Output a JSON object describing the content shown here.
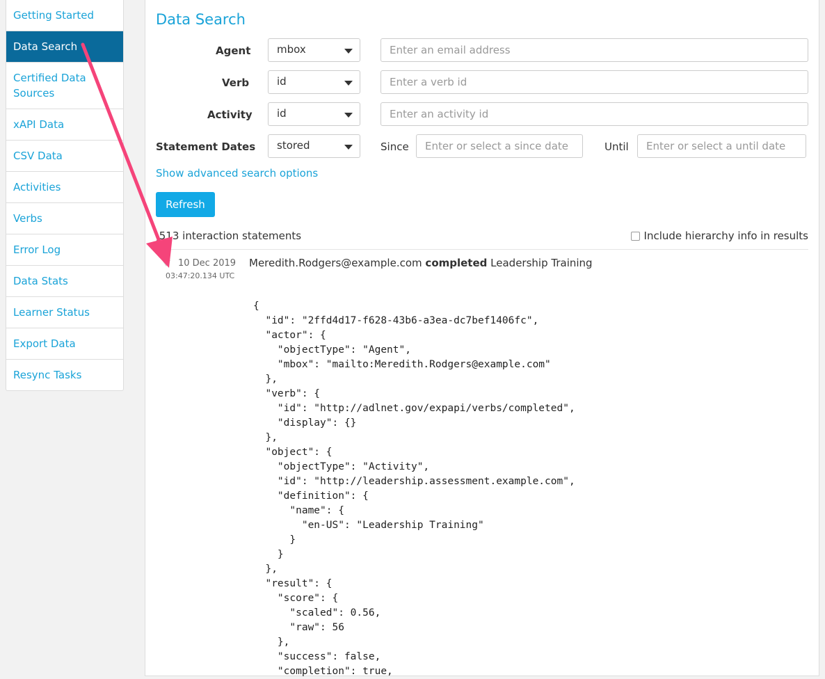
{
  "sidebar": {
    "items": [
      {
        "label": "Getting Started"
      },
      {
        "label": "Data Search"
      },
      {
        "label": "Certified Data Sources"
      },
      {
        "label": "xAPI Data"
      },
      {
        "label": "CSV Data"
      },
      {
        "label": "Activities"
      },
      {
        "label": "Verbs"
      },
      {
        "label": "Error Log"
      },
      {
        "label": "Data Stats"
      },
      {
        "label": "Learner Status"
      },
      {
        "label": "Export Data"
      },
      {
        "label": "Resync Tasks"
      }
    ],
    "active": "Data Search"
  },
  "main": {
    "title": "Data Search",
    "agent": {
      "label": "Agent",
      "select": "mbox",
      "placeholder": "Enter an email address"
    },
    "verb": {
      "label": "Verb",
      "select": "id",
      "placeholder": "Enter a verb id"
    },
    "activity": {
      "label": "Activity",
      "select": "id",
      "placeholder": "Enter an activity id"
    },
    "dates": {
      "label": "Statement Dates",
      "select": "stored",
      "since_label": "Since",
      "since_placeholder": "Enter or select a since date",
      "until_label": "Until",
      "until_placeholder": "Enter or select a until date"
    },
    "advanced_link": "Show advanced search options",
    "refresh_label": "Refresh",
    "count_text": ",513 interaction statements",
    "hierarchy_label": "Include hierarchy info in results",
    "statement": {
      "date": "10 Dec 2019",
      "time": "03:47:20.134 UTC",
      "actor": "Meredith.Rodgers@example.com",
      "verb": "completed",
      "object": "Leadership Training",
      "json": "{\n  \"id\": \"2ffd4d17-f628-43b6-a3ea-dc7bef1406fc\",\n  \"actor\": {\n    \"objectType\": \"Agent\",\n    \"mbox\": \"mailto:Meredith.Rodgers@example.com\"\n  },\n  \"verb\": {\n    \"id\": \"http://adlnet.gov/expapi/verbs/completed\",\n    \"display\": {}\n  },\n  \"object\": {\n    \"objectType\": \"Activity\",\n    \"id\": \"http://leadership.assessment.example.com\",\n    \"definition\": {\n      \"name\": {\n        \"en-US\": \"Leadership Training\"\n      }\n    }\n  },\n  \"result\": {\n    \"score\": {\n      \"scaled\": 0.56,\n      \"raw\": 56\n    },\n    \"success\": false,\n    \"completion\": true,"
    }
  },
  "colors": {
    "accent": "#1aa3d8",
    "active_nav": "#0a6a9b",
    "button": "#12a9e6",
    "annotation_arrow": "#f5447a"
  },
  "icons": {
    "toggle": "triangle-down-icon",
    "dropdown": "chevron-down-icon",
    "annotation": "arrow-icon"
  }
}
